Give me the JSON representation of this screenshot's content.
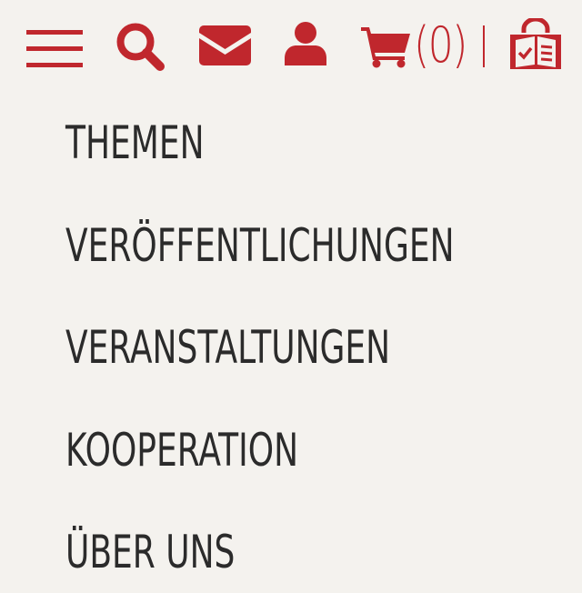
{
  "header": {
    "icons": {
      "menu": "hamburger-menu-icon",
      "search": "search-icon",
      "mail": "envelope-icon",
      "user": "user-icon",
      "cart": "shopping-cart-icon",
      "shop": "shop-bag-icon"
    },
    "cart_count": "(0)"
  },
  "nav": {
    "items": [
      {
        "label": "THEMEN"
      },
      {
        "label": "VERÖFFENTLICHUNGEN"
      },
      {
        "label": "VERANSTALTUNGEN"
      },
      {
        "label": "KOOPERATION"
      },
      {
        "label": "ÜBER UNS"
      }
    ]
  },
  "colors": {
    "accent": "#c0272d",
    "background": "#f4f2ee",
    "text": "#2b2b2b"
  }
}
